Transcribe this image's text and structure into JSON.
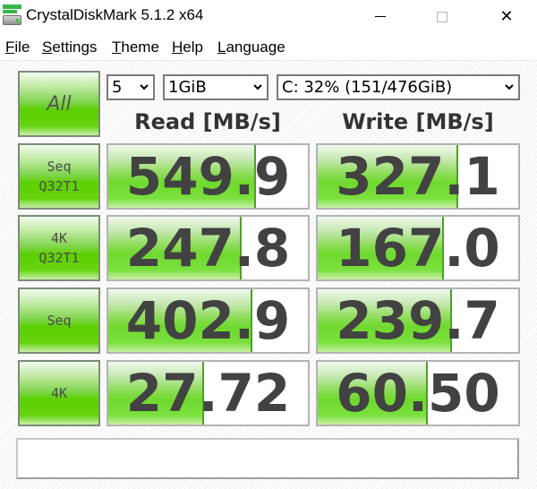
{
  "window": {
    "title": "CrystalDiskMark 5.1.2 x64",
    "icon": "crystaldiskmark-drive-icon",
    "controls": {
      "minimize": "minimize-icon",
      "maximize": "maximize-icon",
      "close_glyph": "✕"
    }
  },
  "menu": [
    {
      "label": "File",
      "accel": "F",
      "rest": "ile"
    },
    {
      "label": "Settings",
      "accel": "S",
      "rest": "ettings"
    },
    {
      "label": "Theme",
      "accel": "T",
      "rest": "heme"
    },
    {
      "label": "Help",
      "accel": "H",
      "rest": "elp"
    },
    {
      "label": "Language",
      "accel": "L",
      "rest": "anguage"
    }
  ],
  "controls": {
    "all_button": "All",
    "test_count": "5",
    "test_size": "1GiB",
    "drive": "C: 32% (151/476GiB)"
  },
  "headers": {
    "read": "Read [MB/s]",
    "write": "Write [MB/s]"
  },
  "colors": {
    "accent_green": "#5bd000",
    "text": "#424242"
  },
  "rows": [
    {
      "line1": "Seq",
      "line2": "Q32T1",
      "read": "549.9",
      "read_fill": 0.74,
      "write": "327.1",
      "write_fill": 0.7
    },
    {
      "line1": "4K",
      "line2": "Q32T1",
      "read": "247.8",
      "read_fill": 0.67,
      "write": "167.0",
      "write_fill": 0.63
    },
    {
      "line1": "Seq",
      "line2": "",
      "read": "402.9",
      "read_fill": 0.72,
      "write": "239.7",
      "write_fill": 0.67
    },
    {
      "line1": "4K",
      "line2": "",
      "read": "27.72",
      "read_fill": 0.48,
      "write": "60.50",
      "write_fill": 0.55
    }
  ],
  "comment": ""
}
